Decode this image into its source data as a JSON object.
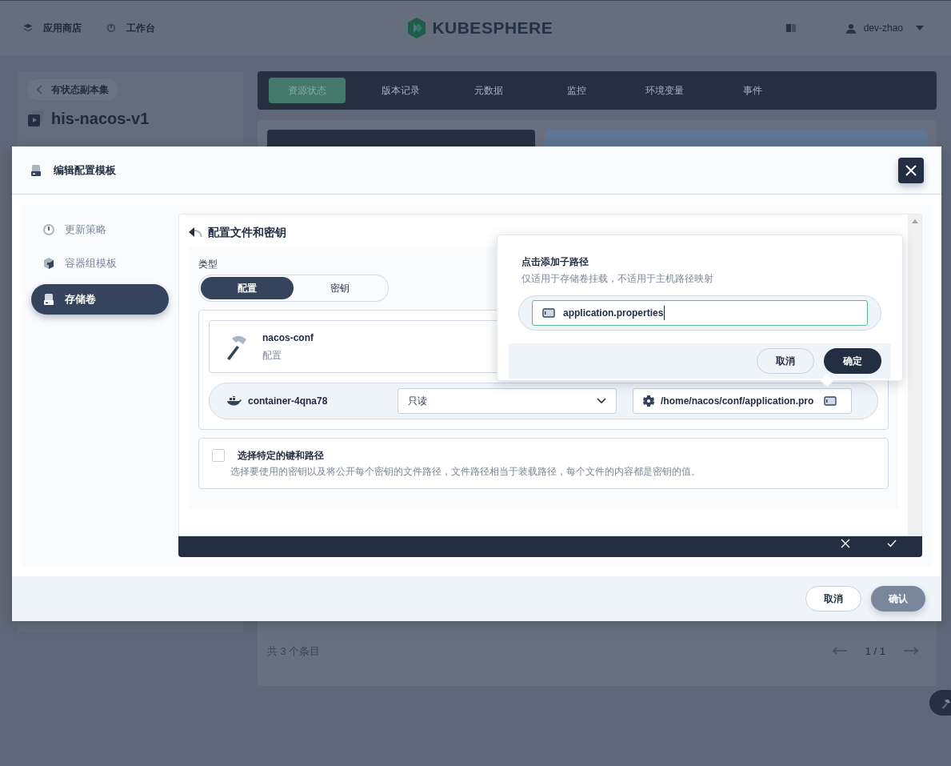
{
  "header": {
    "nav": [
      {
        "label": "应用商店",
        "kind": "store"
      },
      {
        "label": "工作台",
        "kind": "workbench"
      }
    ],
    "logo": "KUBESPHERE",
    "user": "dev-zhao"
  },
  "sidebar": {
    "back": "有状态副本集",
    "title": "his-nacos-v1"
  },
  "tabs": [
    {
      "label": "资源状态",
      "selected": true
    },
    {
      "label": "版本记录",
      "selected": false
    },
    {
      "label": "元数据",
      "selected": false
    },
    {
      "label": "监控",
      "selected": false
    },
    {
      "label": "环境变量",
      "selected": false
    },
    {
      "label": "事件",
      "selected": false
    }
  ],
  "list_footer": {
    "total": "共 3 个条目",
    "page": "1 / 1"
  },
  "modal": {
    "title": "编辑配置模板",
    "steps": [
      {
        "label": "更新策略",
        "kind": "gauge",
        "selected": false
      },
      {
        "label": "容器组模板",
        "kind": "cube",
        "selected": false
      },
      {
        "label": "存储卷",
        "kind": "disk",
        "selected": true
      }
    ],
    "section_title": "配置文件和密钥",
    "type_label": "类型",
    "type_options": [
      {
        "label": "配置",
        "selected": true
      },
      {
        "label": "密钥",
        "selected": false
      }
    ],
    "resource": {
      "name": "nacos-conf",
      "type": "配置"
    },
    "mount": {
      "container": "container-4qna78",
      "access": "只读",
      "path": "/home/nacos/conf/application.pro"
    },
    "specific_keys": {
      "checked": false,
      "label": "选择特定的键和路径",
      "description": "选择要使用的密钥以及将公开每个密钥的文件路径，文件路径相当于装载路径，每个文件的内容都是密钥的值。"
    },
    "footer_buttons": [
      {
        "label": "取消",
        "kind": "secondary"
      },
      {
        "label": "确认",
        "kind": "primary"
      }
    ]
  },
  "popover": {
    "title": "点击添加子路径",
    "hint": "仅适用于存储卷挂载，不适用于主机路径映射",
    "value": "application.properties",
    "buttons": [
      {
        "label": "取消",
        "kind": "secondary"
      },
      {
        "label": "确定",
        "kind": "primary"
      }
    ]
  }
}
